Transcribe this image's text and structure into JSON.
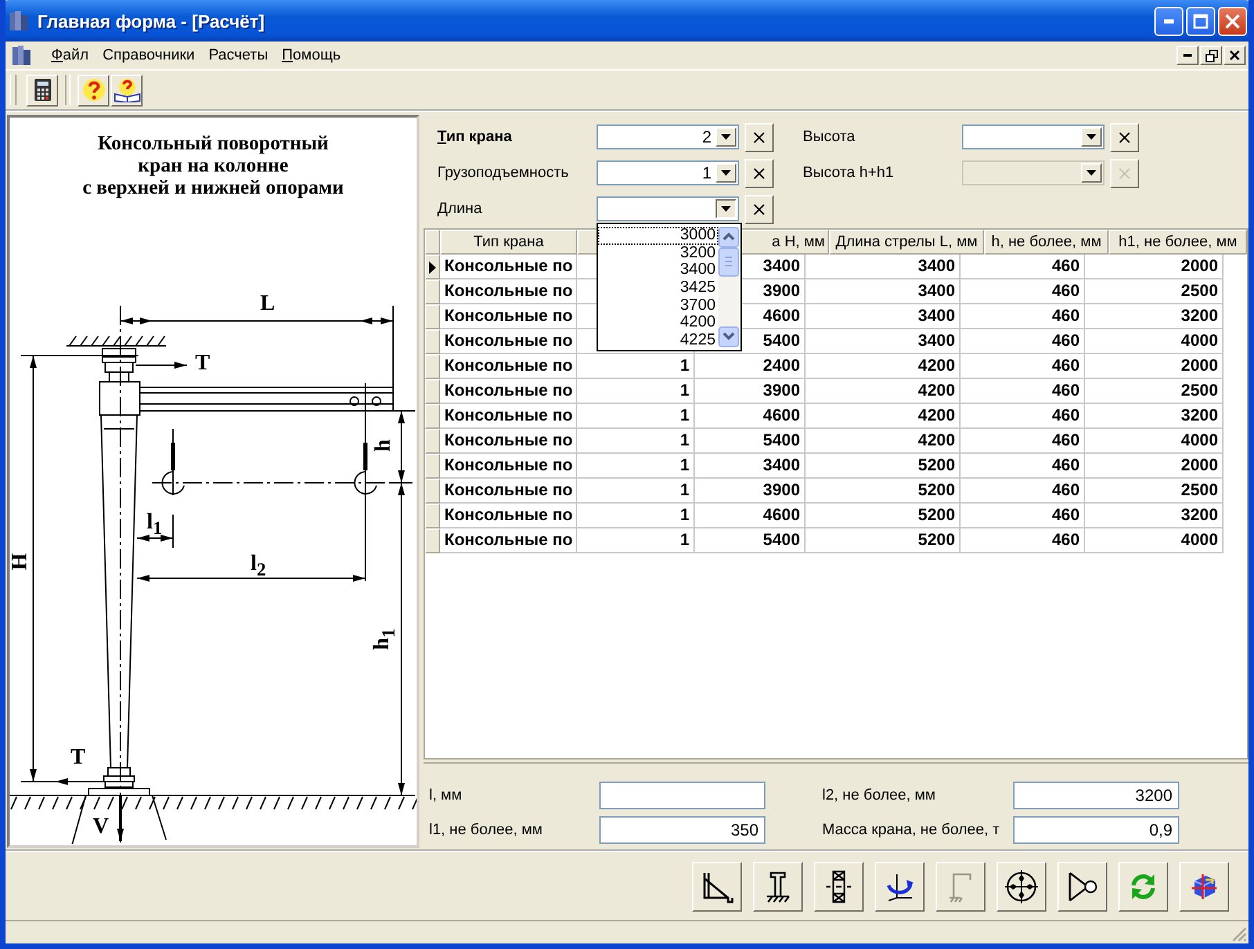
{
  "window": {
    "title": "Главная форма - [Расчёт]"
  },
  "menu": [
    {
      "label": "Файл",
      "underline_first": true
    },
    {
      "label": "Справочники",
      "underline_first": false
    },
    {
      "label": "Расчеты",
      "underline_first": false
    },
    {
      "label": "Помощь",
      "underline_first": true
    }
  ],
  "scheme": {
    "title": "Консольный поворотный\nкран на колонне\nс верхней и нижней опорами",
    "labels": [
      {
        "text": "L",
        "rotated": false
      },
      {
        "text": "T",
        "rotated": false
      },
      {
        "text": "h",
        "rotated": true
      },
      {
        "text": "H",
        "rotated": true
      },
      {
        "text": "l$_{1}$",
        "rotated": false
      },
      {
        "text": "l$_{2}$",
        "rotated": false
      },
      {
        "text": "h$_{1}$",
        "rotated": true
      },
      {
        "text": "T",
        "rotated": false
      },
      {
        "text": "V",
        "rotated": false
      }
    ]
  },
  "filters": [
    {
      "label": "Тип крана",
      "bold": true,
      "underline_first": true,
      "value": "2",
      "disabled": false,
      "open": false
    },
    {
      "label": "Высота",
      "bold": false,
      "underline_first": false,
      "disabled": false,
      "open": false
    },
    {
      "label": "Грузоподъемность",
      "bold": false,
      "underline_first": false,
      "value": "1",
      "disabled": false,
      "open": false
    },
    {
      "label": "Высота h+h1",
      "bold": false,
      "underline_first": false,
      "disabled": true,
      "open": false
    },
    {
      "label": "Длина",
      "bold": false,
      "underline_first": false,
      "disabled": false,
      "open": true,
      "options": [
        {
          "label": "3000",
          "selected": true
        },
        {
          "label": "3200",
          "selected": false
        },
        {
          "label": "3400",
          "selected": false
        },
        {
          "label": "3425",
          "selected": false
        },
        {
          "label": "3700",
          "selected": false
        },
        {
          "label": "4200",
          "selected": false
        },
        {
          "label": "4225",
          "selected": false
        }
      ]
    }
  ],
  "table": {
    "columns": [
      "Тип крана",
      null,
      "а H, мм",
      "Длина стрелы L, мм",
      "h, не более, мм",
      "h1, не более, мм"
    ],
    "rows": [
      {
        "current": true,
        "cells": [
          "Консольные по",
          null,
          "3400",
          "3400",
          "460",
          "2000"
        ]
      },
      {
        "current": false,
        "cells": [
          "Консольные по",
          null,
          "3900",
          "3400",
          "460",
          "2500"
        ]
      },
      {
        "current": false,
        "cells": [
          "Консольные по",
          null,
          "4600",
          "3400",
          "460",
          "3200"
        ]
      },
      {
        "current": false,
        "cells": [
          "Консольные по",
          null,
          "5400",
          "3400",
          "460",
          "4000"
        ]
      },
      {
        "current": false,
        "cells": [
          "Консольные по",
          "1",
          "2400",
          "4200",
          "460",
          "2000"
        ]
      },
      {
        "current": false,
        "cells": [
          "Консольные по",
          "1",
          "3900",
          "4200",
          "460",
          "2500"
        ]
      },
      {
        "current": false,
        "cells": [
          "Консольные по",
          "1",
          "4600",
          "4200",
          "460",
          "3200"
        ]
      },
      {
        "current": false,
        "cells": [
          "Консольные по",
          "1",
          "5400",
          "4200",
          "460",
          "4000"
        ]
      },
      {
        "current": false,
        "cells": [
          "Консольные по",
          "1",
          "3400",
          "5200",
          "460",
          "2000"
        ]
      },
      {
        "current": false,
        "cells": [
          "Консольные по",
          "1",
          "3900",
          "5200",
          "460",
          "2500"
        ]
      },
      {
        "current": false,
        "cells": [
          "Консольные по",
          "1",
          "4600",
          "5200",
          "460",
          "3200"
        ]
      },
      {
        "current": false,
        "cells": [
          "Консольные по",
          "1",
          "5400",
          "5200",
          "460",
          "4000"
        ]
      }
    ]
  },
  "results": [
    {
      "label": "l, мм"
    },
    {
      "label": "l2, не более, мм",
      "value": "3200"
    },
    {
      "label": "l1, не более, мм",
      "value": "350"
    },
    {
      "label": "Масса крана, не более, т",
      "value": "0,9"
    }
  ],
  "action_buttons": [
    {
      "disabled": false
    },
    {
      "disabled": false
    },
    {
      "disabled": false
    },
    {
      "disabled": false
    },
    {
      "disabled": true
    },
    {
      "disabled": false
    },
    {
      "disabled": false
    },
    {
      "disabled": false
    },
    {
      "disabled": false
    }
  ]
}
